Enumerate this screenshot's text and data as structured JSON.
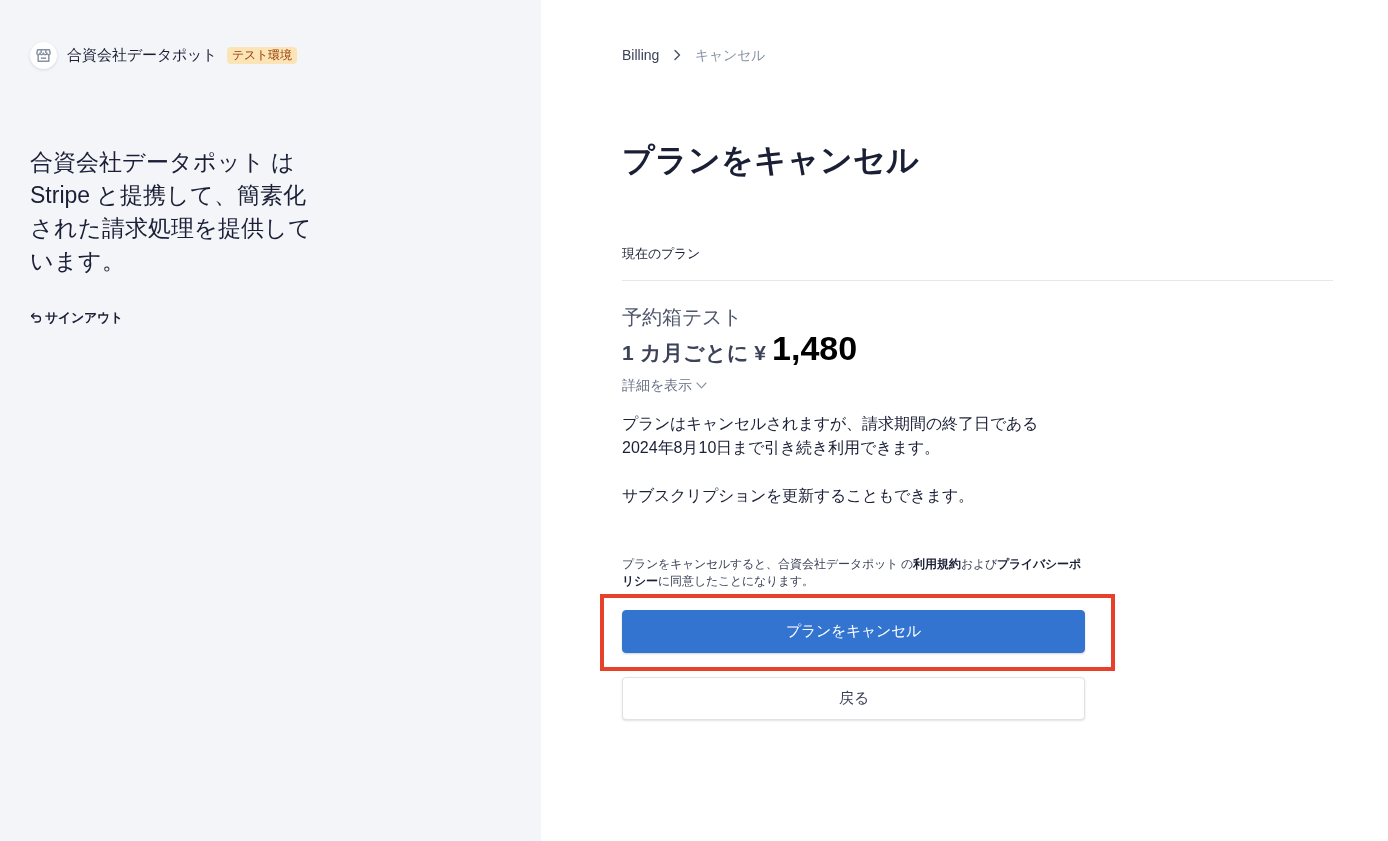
{
  "merchant": {
    "name": "合資会社データポット",
    "badge": "テスト環境"
  },
  "sidebar": {
    "headline": "合資会社データポット は Stripe と提携して、簡素化された請求処理を提供しています。",
    "sign_out": "サインアウト"
  },
  "breadcrumb": [
    {
      "label": "Billing",
      "current": false
    },
    {
      "label": "キャンセル",
      "current": true
    }
  ],
  "title": "プランをキャンセル",
  "current_plan": {
    "heading": "現在のプラン",
    "name": "予約箱テスト",
    "interval": "1 カ月ごとに ¥",
    "amount": "1,480",
    "details_link": "詳細を表示",
    "expanded": false
  },
  "messages": [
    "プランはキャンセルされますが、請求期間の終了日である2024年8月10日まで引き続き利用できます。",
    "サブスクリプションを更新することもできます。"
  ],
  "terms": "プランをキャンセルすると、合資会社データポット の**利用規約**および**プライバシーポリシー**に同意したことになります。",
  "buttons": [
    {
      "label": "プランをキャンセル",
      "kind": "primary",
      "highlighted": true
    },
    {
      "label": "戻る",
      "kind": "secondary",
      "highlighted": false
    }
  ]
}
